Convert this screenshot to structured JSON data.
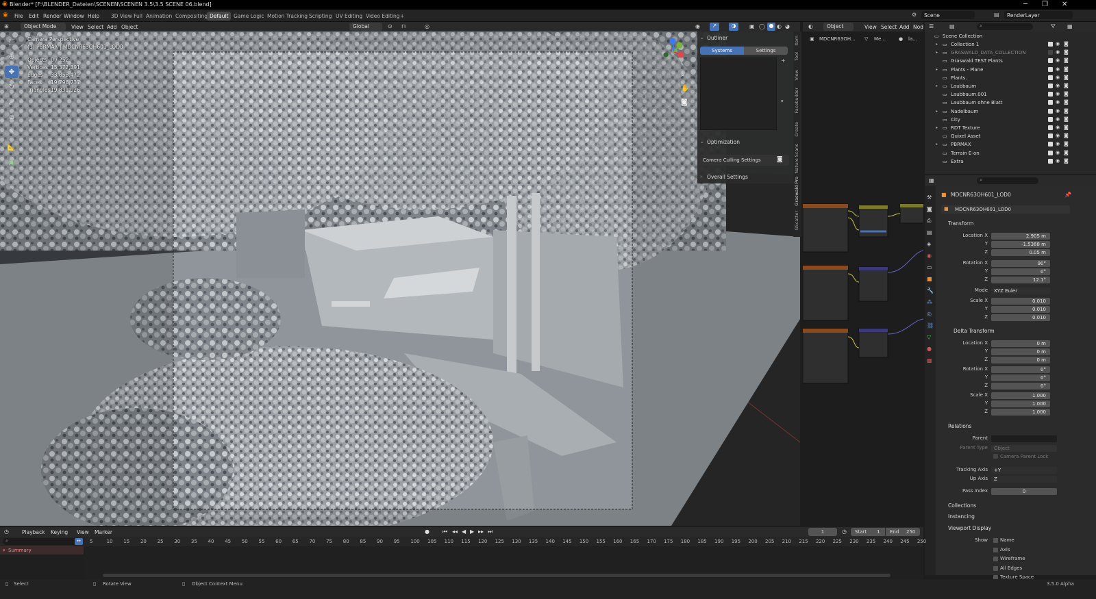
{
  "window": {
    "title": "Blender* [F:\\BLENDER_Dateien\\SCENEN\\SCENEN 3.5\\3.5 SCENE 06.blend]"
  },
  "menu": {
    "items": [
      "File",
      "Edit",
      "Render",
      "Window",
      "Help"
    ]
  },
  "workspaces": {
    "tabs": [
      "3D View Full",
      "Animation",
      "Compositing",
      "Default",
      "Game Logic",
      "Motion Tracking",
      "Scripting",
      "UV Editing",
      "Video Editing"
    ],
    "active": "Default",
    "add": "+"
  },
  "scene": {
    "name": "Scene",
    "render_layer": "RenderLayer"
  },
  "viewport_header": {
    "mode": "Object Mode",
    "menus": [
      "View",
      "Select",
      "Add",
      "Object"
    ],
    "orientation": "Global"
  },
  "viewport": {
    "camera_label": "Camera Perspective",
    "object_label": "(1) PBRMAX | MDCNR63OH601_LOD0",
    "stats": [
      {
        "label": "Objects",
        "value": "0 / 252"
      },
      {
        "label": "Vertices",
        "value": "15,372,391"
      },
      {
        "label": "Edges",
        "value": "33,858,472"
      },
      {
        "label": "Faces",
        "value": "19,796,737"
      },
      {
        "label": "Triangles",
        "value": "19,831,926"
      }
    ]
  },
  "npanel": {
    "outliner_title": "Outliner",
    "tab_systems": "Systems",
    "tab_settings": "Settings",
    "optimization": "Optimization",
    "camera_culling": "Camera Culling Settings",
    "overall": "Overall Settings",
    "side_tabs": [
      "Item",
      "Tool",
      "View",
      "Facebuilder",
      "Create",
      "Nature Scans",
      "Graswald Pro",
      "GScatter"
    ]
  },
  "node_editor": {
    "mode": "Object",
    "menus": [
      "View",
      "Select",
      "Add",
      "Nod"
    ],
    "crumb_object": "MDCNR63OH...",
    "crumb_mesh": "Me...",
    "crumb_mat": "la..."
  },
  "outliner": {
    "root": "Scene Collection",
    "items": [
      {
        "name": "Collection 1",
        "expand": true
      },
      {
        "name": "GRASWALD_DATA_COLLECTION",
        "expand": true,
        "dim": true
      },
      {
        "name": "Graswald TEST Plants",
        "expand": false
      },
      {
        "name": "Plants - Plane",
        "expand": true
      },
      {
        "name": "Plants.",
        "expand": false
      },
      {
        "name": "Laubbaum",
        "expand": true
      },
      {
        "name": "Laubbaum.001",
        "expand": false
      },
      {
        "name": "Laubbaum ohne Blatt",
        "expand": false
      },
      {
        "name": "Nadelbaum",
        "expand": true
      },
      {
        "name": "City",
        "expand": false
      },
      {
        "name": "RDT Texture",
        "expand": true
      },
      {
        "name": "Quixel Asset",
        "expand": false
      },
      {
        "name": "PBRMAX",
        "expand": true
      },
      {
        "name": "Terrain E-on",
        "expand": false
      },
      {
        "name": "Extra",
        "expand": false
      }
    ]
  },
  "properties": {
    "object_name": "MDCNR63OH601_LOD0",
    "object_field": "MDCNR63OH601_LOD0",
    "transform": "Transform",
    "location": {
      "label": "Location X",
      "x": "2.905 m",
      "y": "-1.5368 m",
      "z": "0.05 m"
    },
    "rotation": {
      "label": "Rotation X",
      "x": "90°",
      "y": "0°",
      "z": "12.1°"
    },
    "mode_label": "Mode",
    "mode": "XYZ Euler",
    "scale": {
      "label": "Scale X",
      "x": "0.010",
      "y": "0.010",
      "z": "0.010"
    },
    "delta_transform": "Delta Transform",
    "delta_location": {
      "label": "Location X",
      "x": "0 m",
      "y": "0 m",
      "z": "0 m"
    },
    "delta_rotation": {
      "label": "Rotation X",
      "x": "0°",
      "y": "0°",
      "z": "0°"
    },
    "delta_scale": {
      "label": "Scale X",
      "x": "1.000",
      "y": "1.000",
      "z": "1.000"
    },
    "axis_y": "Y",
    "axis_z": "Z",
    "relations": "Relations",
    "parent": "Parent",
    "parent_type": "Parent Type",
    "parent_type_value": "Object",
    "camera_parent_lock": "Camera Parent Lock",
    "tracking_axis": "Tracking Axis",
    "tracking_axis_value": "+Y",
    "up_axis": "Up Axis",
    "up_axis_value": "Z",
    "pass_index": "Pass Index",
    "pass_index_value": "0",
    "collections": "Collections",
    "instancing": "Instancing",
    "viewport_display": "Viewport Display",
    "show": "Show",
    "show_items": [
      "Name",
      "Axis",
      "Wireframe",
      "All Edges",
      "Texture Space"
    ]
  },
  "timeline": {
    "menus": [
      "Playback",
      "Keying",
      "View",
      "Marker"
    ],
    "current_frame": "1",
    "start_label": "Start",
    "start": "1",
    "end_label": "End",
    "end": "250",
    "ticks": [
      "5",
      "10",
      "15",
      "20",
      "25",
      "30",
      "35",
      "40",
      "45",
      "50",
      "55",
      "60",
      "65",
      "70",
      "75",
      "80",
      "85",
      "90",
      "95",
      "100",
      "105",
      "110",
      "115",
      "120",
      "125",
      "130",
      "135",
      "140",
      "145",
      "150",
      "155",
      "160",
      "165",
      "170",
      "175",
      "180",
      "185",
      "190",
      "195",
      "200",
      "205",
      "210",
      "215",
      "220",
      "225",
      "230",
      "235",
      "240",
      "245",
      "250"
    ],
    "summary": "Summary"
  },
  "status": {
    "select": "Select",
    "rotate": "Rotate View",
    "context": "Object Context Menu",
    "version": "3.5.0 Alpha"
  },
  "colors": {
    "accent": "#4772b3",
    "header": "#2a2a2a",
    "panel": "#2b2b2b"
  }
}
